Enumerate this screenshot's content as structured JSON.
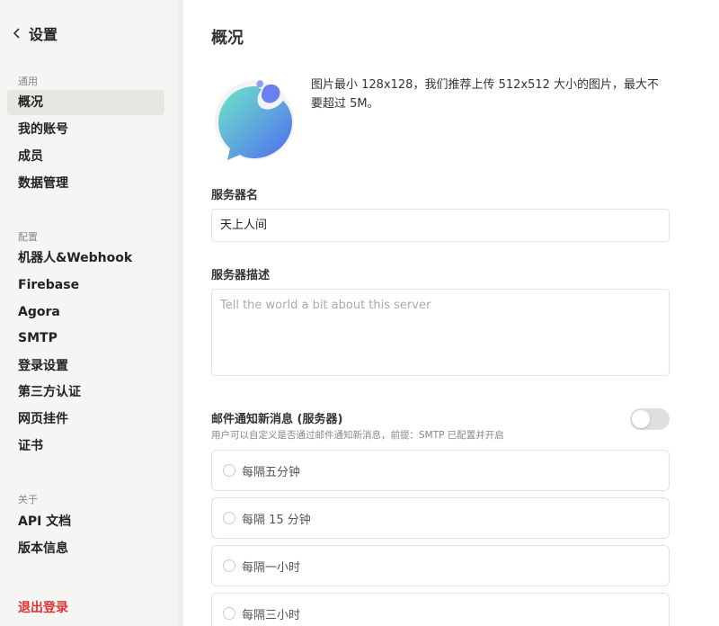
{
  "sidebar": {
    "title": "设置",
    "sections": {
      "general": "通用",
      "config": "配置",
      "about": "关于"
    },
    "items": {
      "overview": "概况",
      "account": "我的账号",
      "members": "成员",
      "data": "数据管理",
      "bots": "机器人&Webhook",
      "firebase": "Firebase",
      "agora": "Agora",
      "smtp": "SMTP",
      "login": "登录设置",
      "oauth": "第三方认证",
      "widget": "网页挂件",
      "cert": "证书",
      "api": "API 文档",
      "version": "版本信息"
    },
    "logout": "退出登录"
  },
  "main": {
    "title": "概况",
    "avatar_hint": "图片最小 128x128，我们推荐上传 512x512 大小的图片，最大不要超过 5M。",
    "server_name_label": "服务器名",
    "server_name_value": "天上人间",
    "server_desc_label": "服务器描述",
    "server_desc_placeholder": "Tell the world a bit about this server",
    "email_label": "邮件通知新消息 (服务器)",
    "email_hint": "用户可以自定义是否通过邮件通知新消息，前提：SMTP 已配置并开启",
    "email_enabled": false,
    "frequency_options": [
      "每隔五分钟",
      "每隔 15 分钟",
      "每隔一小时",
      "每隔三小时"
    ]
  },
  "colors": {
    "sidebar_bg": "#f5f5f4",
    "active_bg": "#e8e6e3",
    "logout": "#e03131",
    "avatar_gradient_start": "#6ee7c7",
    "avatar_gradient_end": "#4f6bf0"
  }
}
